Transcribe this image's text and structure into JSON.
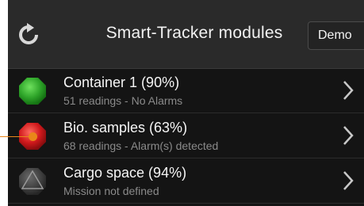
{
  "header": {
    "title": "Smart-Tracker modules",
    "demo_label": "Demo",
    "refresh_icon": "refresh-icon"
  },
  "modules": [
    {
      "title": "Container 1 (90%)",
      "subtitle": "51 readings - No Alarms",
      "status": "ok",
      "color": "#2fa52a"
    },
    {
      "title": "Bio. samples (63%)",
      "subtitle": "68 readings - Alarm(s) detected",
      "status": "alarm",
      "color": "#d0191c"
    },
    {
      "title": "Cargo space (94%)",
      "subtitle": "Mission not defined",
      "status": "undefined",
      "color": "#5a5a5a"
    }
  ],
  "colors": {
    "background": "#141414",
    "topbar": "#2a2a2a",
    "annotation": "#e9861a"
  }
}
